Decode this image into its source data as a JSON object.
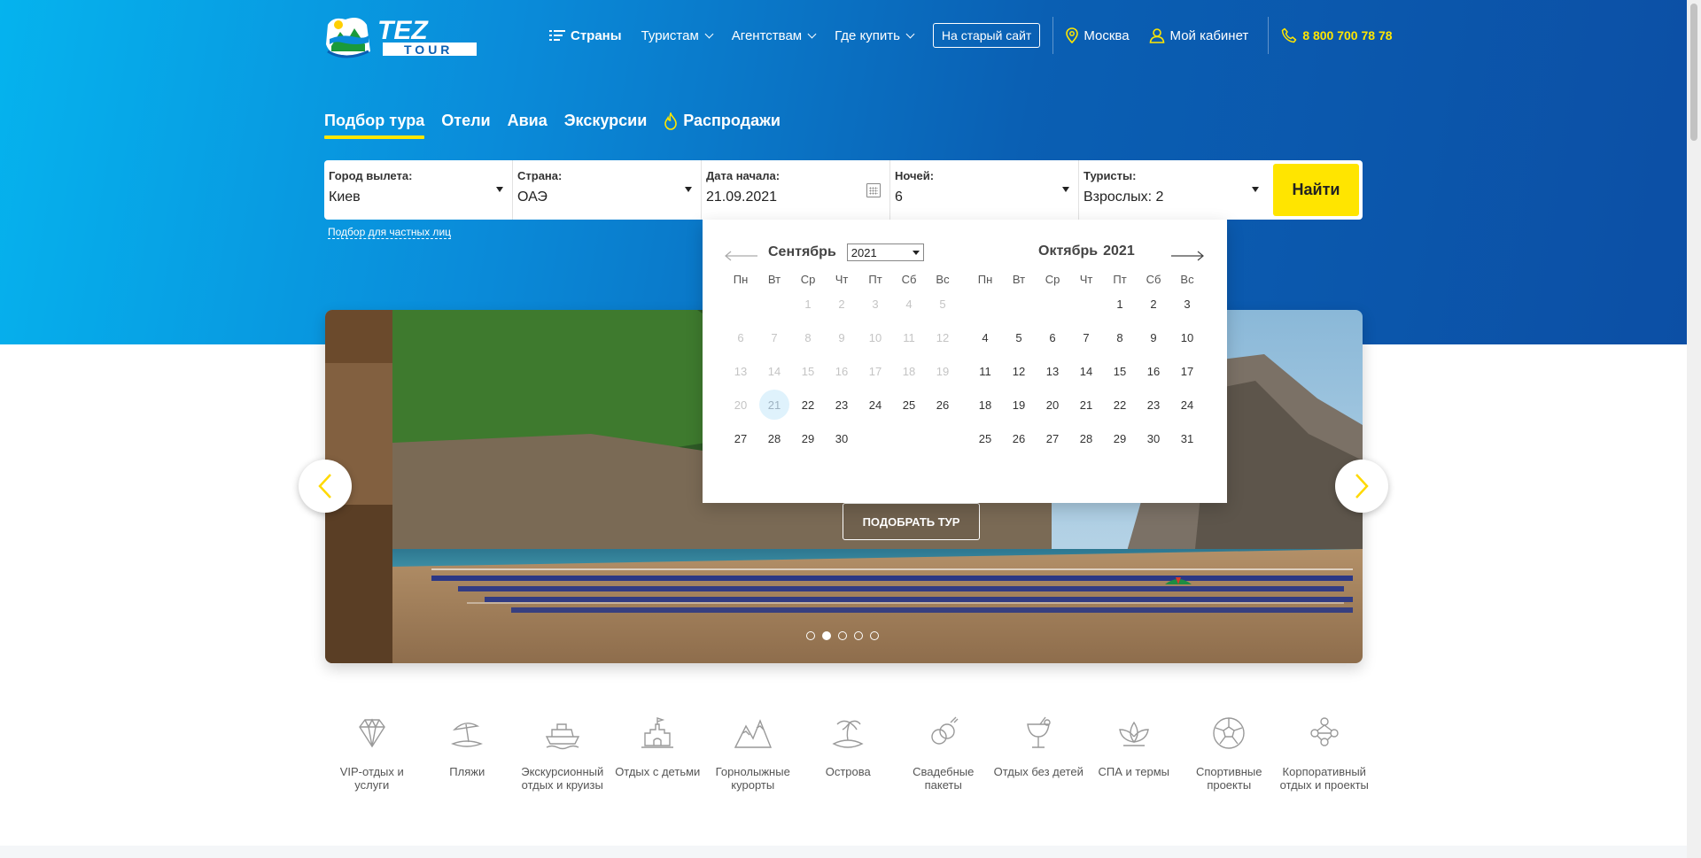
{
  "colors": {
    "accent": "#ffe600",
    "brand_blue": "#0a5fb3",
    "selected_day_bg": "#dff2fc"
  },
  "logo": {
    "text_line1": "TEZ",
    "text_line2": "TOUR"
  },
  "topnav": {
    "countries": "Страны",
    "tourists": "Туристам",
    "agencies": "Агентствам",
    "where_to_buy": "Где купить",
    "old_site": "На старый сайт",
    "city": "Москва",
    "cabinet": "Мой кабинет",
    "phone": "8 800 700 78 78"
  },
  "tabs": [
    {
      "label": "Подбор тура",
      "active": true
    },
    {
      "label": "Отели"
    },
    {
      "label": "Авиа"
    },
    {
      "label": "Экскурсии"
    },
    {
      "label": "Распродажи",
      "icon": "fire-icon"
    }
  ],
  "search": {
    "fields": [
      {
        "label": "Город вылета:",
        "value": "Киев"
      },
      {
        "label": "Страна:",
        "value": "ОАЭ"
      },
      {
        "label": "Дата начала:",
        "value": "21.09.2021"
      },
      {
        "label": "Ночей:",
        "value": "6"
      },
      {
        "label": "Туристы:",
        "value": "Взрослых: 2"
      }
    ],
    "button": "Найти",
    "private_link": "Подбор для частных лиц"
  },
  "calendar": {
    "dow": [
      "Пн",
      "Вт",
      "Ср",
      "Чт",
      "Пт",
      "Сб",
      "Вс"
    ],
    "left": {
      "month": "Сентябрь",
      "year": "2021",
      "weeks": [
        [
          "",
          "",
          "1",
          "2",
          "3",
          "4",
          "5"
        ],
        [
          "6",
          "7",
          "8",
          "9",
          "10",
          "11",
          "12"
        ],
        [
          "13",
          "14",
          "15",
          "16",
          "17",
          "18",
          "19"
        ],
        [
          "20",
          "21",
          "22",
          "23",
          "24",
          "25",
          "26"
        ],
        [
          "27",
          "28",
          "29",
          "30",
          "",
          "",
          ""
        ]
      ],
      "disabled_through": 20,
      "selected": "21"
    },
    "right": {
      "month": "Октябрь",
      "year": "2021",
      "weeks": [
        [
          "",
          "",
          "",
          "",
          "1",
          "2",
          "3"
        ],
        [
          "4",
          "5",
          "6",
          "7",
          "8",
          "9",
          "10"
        ],
        [
          "11",
          "12",
          "13",
          "14",
          "15",
          "16",
          "17"
        ],
        [
          "18",
          "19",
          "20",
          "21",
          "22",
          "23",
          "24"
        ],
        [
          "25",
          "26",
          "27",
          "28",
          "29",
          "30",
          "31"
        ]
      ]
    }
  },
  "slider": {
    "button": "ПОДОБРАТЬ ТУР",
    "slides": 5,
    "active_slide": 2
  },
  "categories": [
    {
      "label": "VIP-отдых и услуги",
      "icon": "diamond-icon"
    },
    {
      "label": "Пляжи",
      "icon": "beach-umbrella-icon"
    },
    {
      "label": "Экскурсионный отдых и круизы",
      "icon": "cruise-ship-icon"
    },
    {
      "label": "Отдых с детьми",
      "icon": "sand-castle-icon"
    },
    {
      "label": "Горнолыжные курорты",
      "icon": "mountains-icon"
    },
    {
      "label": "Острова",
      "icon": "palm-island-icon"
    },
    {
      "label": "Свадебные пакеты",
      "icon": "wedding-icon"
    },
    {
      "label": "Отдых без детей",
      "icon": "cocktail-icon"
    },
    {
      "label": "СПА и термы",
      "icon": "lotus-icon"
    },
    {
      "label": "Спортивные проекты",
      "icon": "soccer-ball-icon"
    },
    {
      "label": "Корпоративный отдых и проекты",
      "icon": "team-icon"
    }
  ]
}
